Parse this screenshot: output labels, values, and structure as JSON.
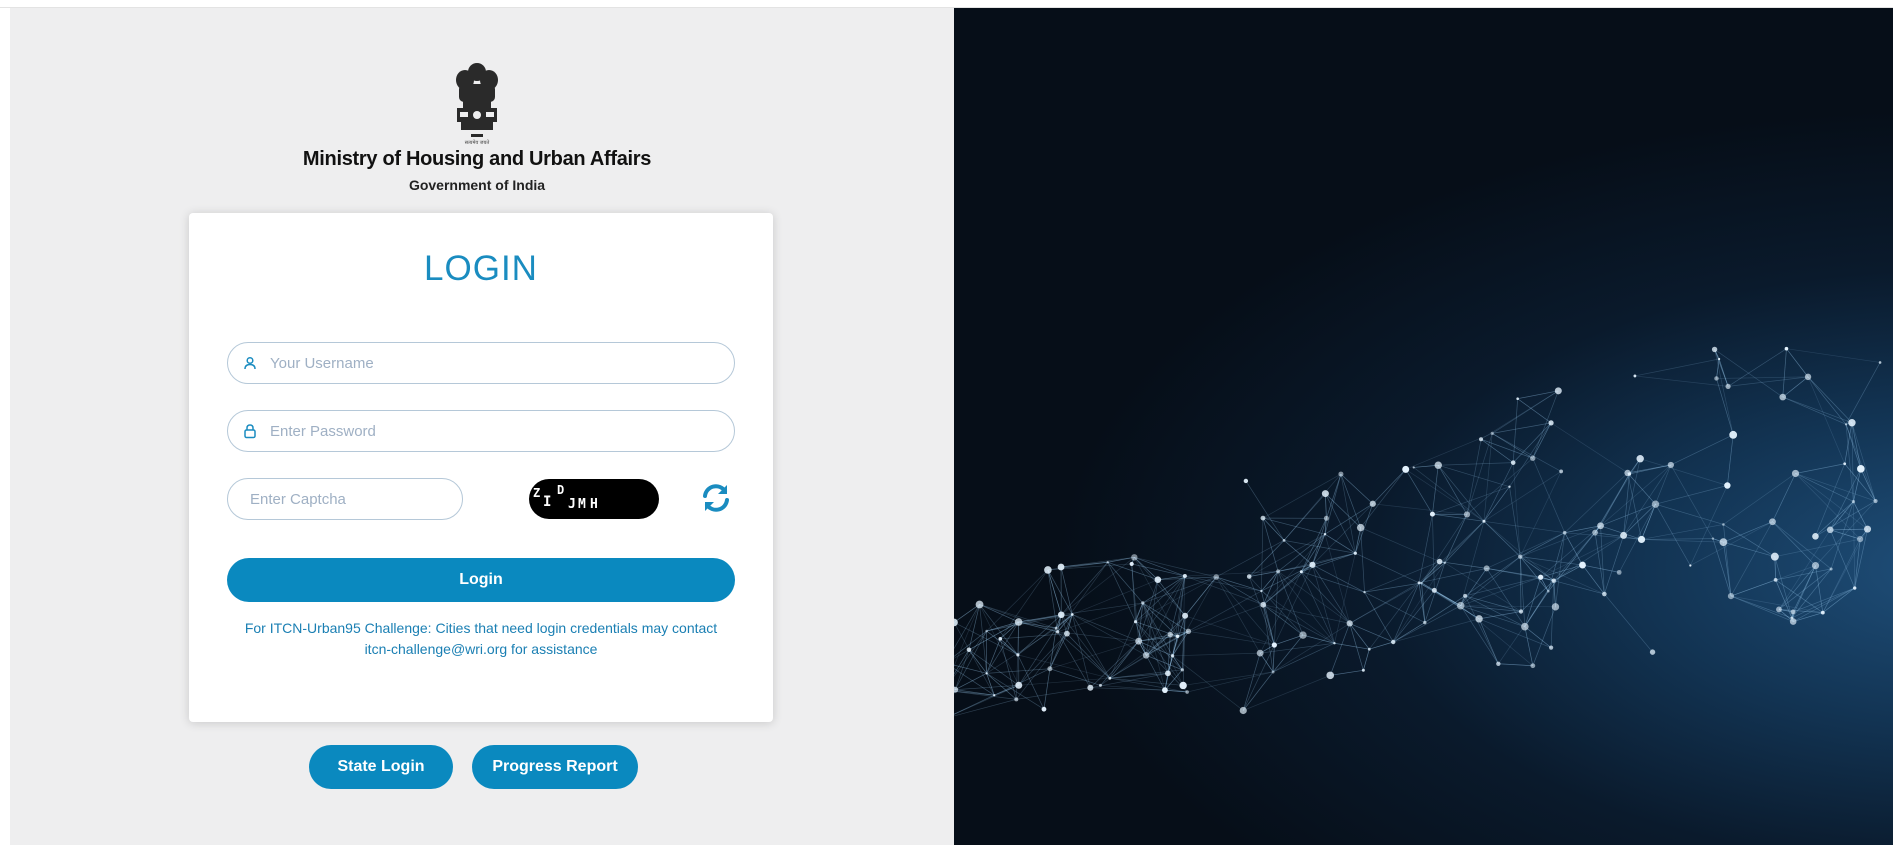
{
  "header": {
    "emblem_caption": "सत्यमेव जयते",
    "ministry_title": "Ministry of Housing and Urban Affairs",
    "ministry_subtitle": "Government of India"
  },
  "login_card": {
    "title": "LOGIN",
    "username": {
      "value": "",
      "placeholder": "Your Username",
      "icon": "user-icon"
    },
    "password": {
      "value": "",
      "placeholder": "Enter Password",
      "icon": "lock-icon"
    },
    "captcha": {
      "value": "",
      "placeholder": "Enter Captcha",
      "image_text": "ZIDJMH",
      "refresh_icon": "refresh-icon"
    },
    "login_button": "Login",
    "note_line1": "For ITCN-Urban95 Challenge: Cities that need login credentials may contact",
    "note_line2": "itcn-challenge@wri.org for assistance"
  },
  "footer_buttons": {
    "state_login": "State Login",
    "progress_report": "Progress Report"
  },
  "colors": {
    "accent": "#0a89bf",
    "title_blue": "#1a8cc0",
    "left_background": "#eeeeef",
    "right_background": "#0a1a2c"
  }
}
